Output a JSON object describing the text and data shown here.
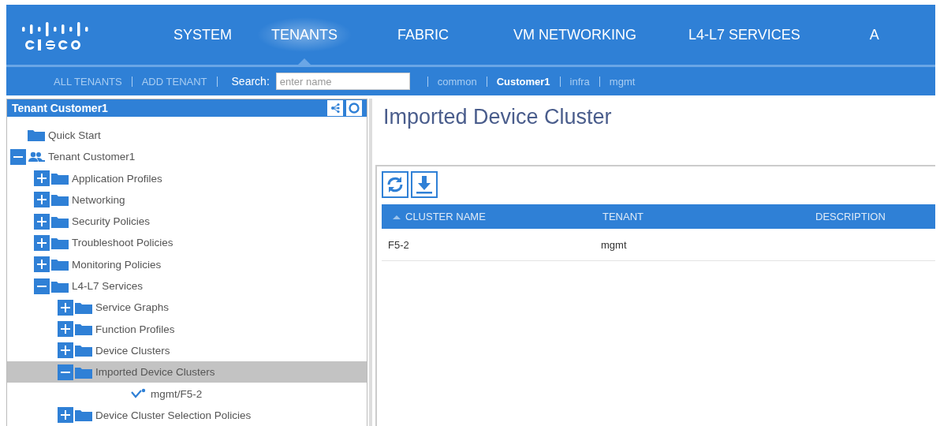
{
  "nav": {
    "tabs": [
      {
        "label": "SYSTEM",
        "selected": false
      },
      {
        "label": "TENANTS",
        "selected": true
      },
      {
        "label": "FABRIC",
        "selected": false
      },
      {
        "label": "VM NETWORKING",
        "selected": false
      },
      {
        "label": "L4-L7 SERVICES",
        "selected": false
      },
      {
        "label": "A",
        "selected": false
      }
    ]
  },
  "subnav": {
    "links": [
      "ALL TENANTS",
      "ADD TENANT"
    ],
    "search_label": "Search:",
    "search": {
      "placeholder": "enter name"
    },
    "tenants": [
      {
        "label": "common",
        "selected": false
      },
      {
        "label": "Customer1",
        "selected": true
      },
      {
        "label": "infra",
        "selected": false
      },
      {
        "label": "mgmt",
        "selected": false
      }
    ]
  },
  "sidebar": {
    "title": "Tenant Customer1",
    "tree": [
      {
        "label": "Quick Start",
        "kind": "folder",
        "selected": false
      },
      {
        "label": "Tenant Customer1",
        "kind": "tenant",
        "expanded": true,
        "selected": false,
        "children": [
          {
            "label": "Application Profiles",
            "kind": "folder",
            "expanded": false,
            "selected": false
          },
          {
            "label": "Networking",
            "kind": "folder",
            "expanded": false,
            "selected": false
          },
          {
            "label": "Security Policies",
            "kind": "folder",
            "expanded": false,
            "selected": false
          },
          {
            "label": "Troubleshoot Policies",
            "kind": "folder",
            "expanded": false,
            "selected": false
          },
          {
            "label": "Monitoring Policies",
            "kind": "folder",
            "expanded": false,
            "selected": false
          },
          {
            "label": "L4-L7 Services",
            "kind": "folder",
            "expanded": true,
            "selected": false,
            "children": [
              {
                "label": "Service Graphs",
                "kind": "folder",
                "expanded": false,
                "selected": false
              },
              {
                "label": "Function Profiles",
                "kind": "folder",
                "expanded": false,
                "selected": false
              },
              {
                "label": "Device Clusters",
                "kind": "folder",
                "expanded": false,
                "selected": false
              },
              {
                "label": "Imported Device Clusters",
                "kind": "folder",
                "expanded": true,
                "selected": true,
                "children": [
                  {
                    "label": "mgmt/F5-2",
                    "kind": "cluster",
                    "selected": false
                  }
                ]
              },
              {
                "label": "Device Cluster Selection Policies",
                "kind": "folder",
                "expanded": false,
                "selected": false
              }
            ]
          }
        ]
      }
    ]
  },
  "content": {
    "title": "Imported Device Cluster",
    "table": {
      "columns": [
        "CLUSTER NAME",
        "TENANT",
        "DESCRIPTION"
      ],
      "rows": [
        [
          "F5-2",
          "mgmt",
          ""
        ]
      ]
    }
  }
}
